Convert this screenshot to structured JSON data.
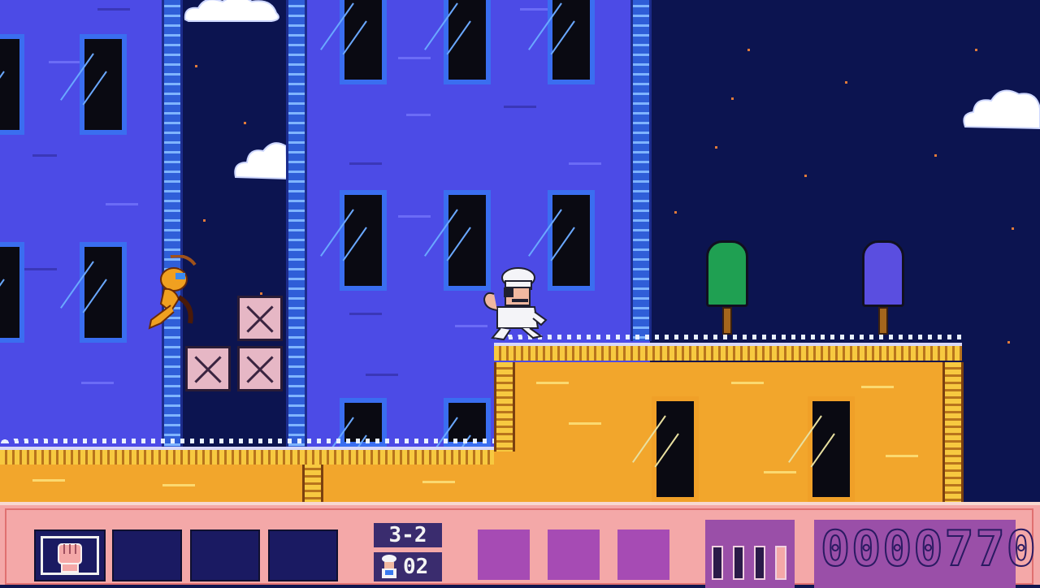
{
  "game": {
    "stage": "3-2",
    "lives": "02",
    "score": "0000770",
    "weapon_icon": "fist-icon",
    "item_slots_empty": 3,
    "bonus_slots_empty": 3,
    "energy_bars_filled": 3,
    "energy_bars_total": 4
  },
  "colors": {
    "sky": "#0c1450",
    "building_blue": "#4c4be6",
    "building_orange": "#f2a62c",
    "hud_pink": "#f4a8a8",
    "hud_purple": "#9a4fa8",
    "hud_navy": "#1a1a62",
    "popsicle_green": "#1fa052",
    "popsicle_blue": "#5a4ee0"
  },
  "characters": {
    "player": "chef-character",
    "enemy": "flying-gremlin-enemy"
  }
}
